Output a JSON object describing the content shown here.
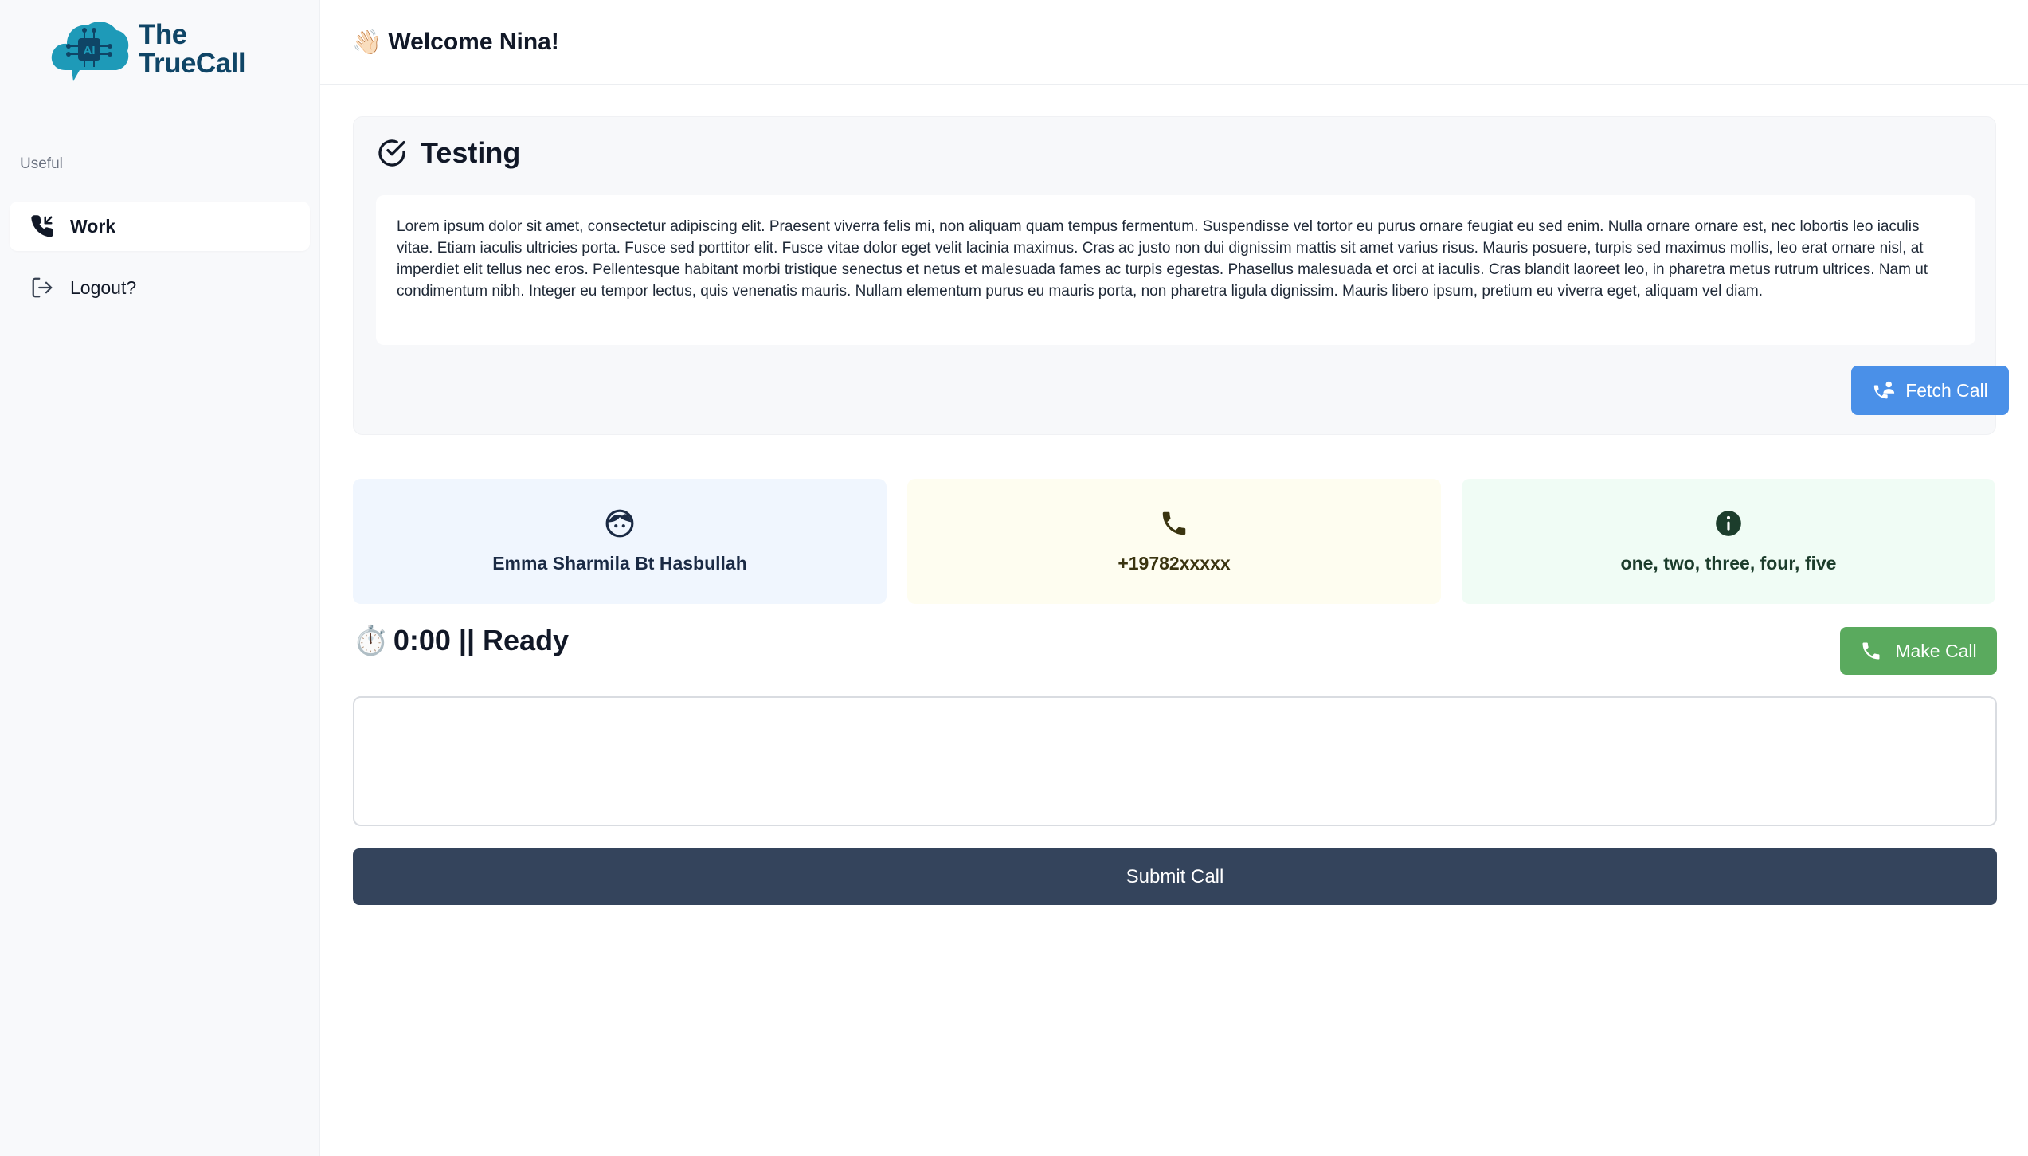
{
  "brand": {
    "logo_line1": "The",
    "logo_line2": "TrueCall",
    "logo_badge": "AI",
    "color": "#0f4566",
    "accent": "#1e9ab8"
  },
  "sidebar": {
    "section_label": "Useful",
    "items": [
      {
        "label": "Work",
        "icon": "phone-incoming-icon",
        "active": true
      },
      {
        "label": "Logout?",
        "icon": "logout-icon",
        "active": false
      }
    ]
  },
  "header": {
    "emoji": "👋🏻",
    "greeting": "Welcome Nina!"
  },
  "testing": {
    "icon": "check-circle-icon",
    "title": "Testing",
    "body": "Lorem ipsum dolor sit amet, consectetur adipiscing elit. Praesent viverra felis mi, non aliquam quam tempus fermentum. Suspendisse vel tortor eu purus ornare feugiat eu sed enim. Nulla ornare ornare est, nec lobortis leo iaculis vitae. Etiam iaculis ultricies porta. Fusce sed porttitor elit. Fusce vitae dolor eget velit lacinia maximus. Cras ac justo non dui dignissim mattis sit amet varius risus. Mauris posuere, turpis sed maximus mollis, leo erat ornare nisl, at imperdiet elit tellus nec eros. Pellentesque habitant morbi tristique senectus et netus et malesuada fames ac turpis egestas. Phasellus malesuada et orci at iaculis. Cras blandit laoreet leo, in pharetra metus rutrum ultrices. Nam ut condimentum nibh. Integer eu tempor lectus, quis venenatis mauris. Nullam elementum purus eu mauris porta, non pharetra ligula dignissim. Mauris libero ipsum, pretium eu viverra eget, aliquam vel diam.",
    "fetch_label": "Fetch Call",
    "fetch_color": "#4a90e8"
  },
  "cards": {
    "name": {
      "icon": "face-icon",
      "value": "Emma Sharmila Bt Hasbullah"
    },
    "phone": {
      "icon": "phone-icon",
      "value": "+19782xxxxx"
    },
    "info": {
      "icon": "info-icon",
      "value": "one, two, three, four, five"
    }
  },
  "call": {
    "timer_emoji": "⏱️",
    "status": "0:00 || Ready",
    "make_label": "Make Call",
    "make_color": "#5aaa5e",
    "notes_value": "",
    "submit_label": "Submit Call",
    "submit_color": "#34445c"
  }
}
